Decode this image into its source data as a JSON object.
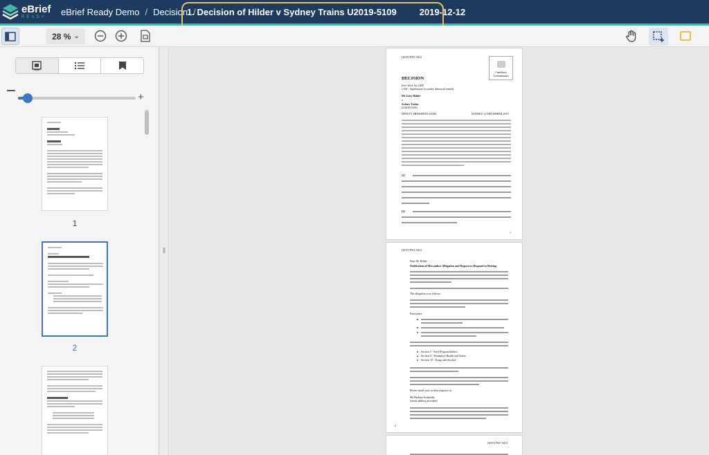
{
  "app": {
    "logo_primary": "eBrief",
    "logo_secondary": "READY",
    "brand_color": "#1e3a5f",
    "accent_color": "#3fb8a8"
  },
  "breadcrumb": {
    "items": [
      "eBrief Ready Demo",
      "Decision"
    ],
    "separator": "/",
    "current_title": "1.  Decision of Hilder v Sydney Trains U2019-5109",
    "current_date": "2019-12-12",
    "highlight_color": "#e8c453"
  },
  "toolbar": {
    "zoom_label": "28 %",
    "zoom_caret": "⌄"
  },
  "sidebar": {
    "thumbnails": [
      {
        "label": "1",
        "selected": false
      },
      {
        "label": "2",
        "selected": true
      },
      {
        "label": "",
        "selected": false
      }
    ],
    "resizer_glyph": "‖"
  },
  "document": {
    "page1": {
      "citation": "[2019] FWC 8412",
      "heading": "DECISION",
      "act_line": "Fair Work Act 2009",
      "section_line": "s.394 - Application for unfair dismissal remedy",
      "applicant": "Mr Gary Hilder",
      "v_line": "v",
      "respondent": "Sydney Trains",
      "matter": "(U2019/5109)",
      "member": "DEPUTY PRESIDENT SAMS",
      "location_date": "SYDNEY, 12 DECEMBER 2019",
      "para1_no": "[1]",
      "para2_no": "[2]",
      "page_no": "1",
      "logo_text_1": "FairWork",
      "logo_text_2": "Commission"
    },
    "page2": {
      "citation": "[2019] FWC 8412",
      "salutation": "Dear Mr Hilder",
      "heading": "Notification of Misconduct Allegation and Request to Respond in Writing",
      "allegation_line": "The allegation is as follows:",
      "particulars": "Particulars:",
      "sections": [
        "Section 5 - Staff Responsibilities",
        "Section 9 - Workplace Health and Safety",
        "Section 10 - Drugs and Alcohol"
      ],
      "reply_line": "Please email your written response to:",
      "name_line": "Ms Barbara Isolanidis,",
      "email_line": "[email address provided]",
      "page_no": "2"
    },
    "page3": {
      "citation": "[2019] FWC 8412"
    }
  }
}
